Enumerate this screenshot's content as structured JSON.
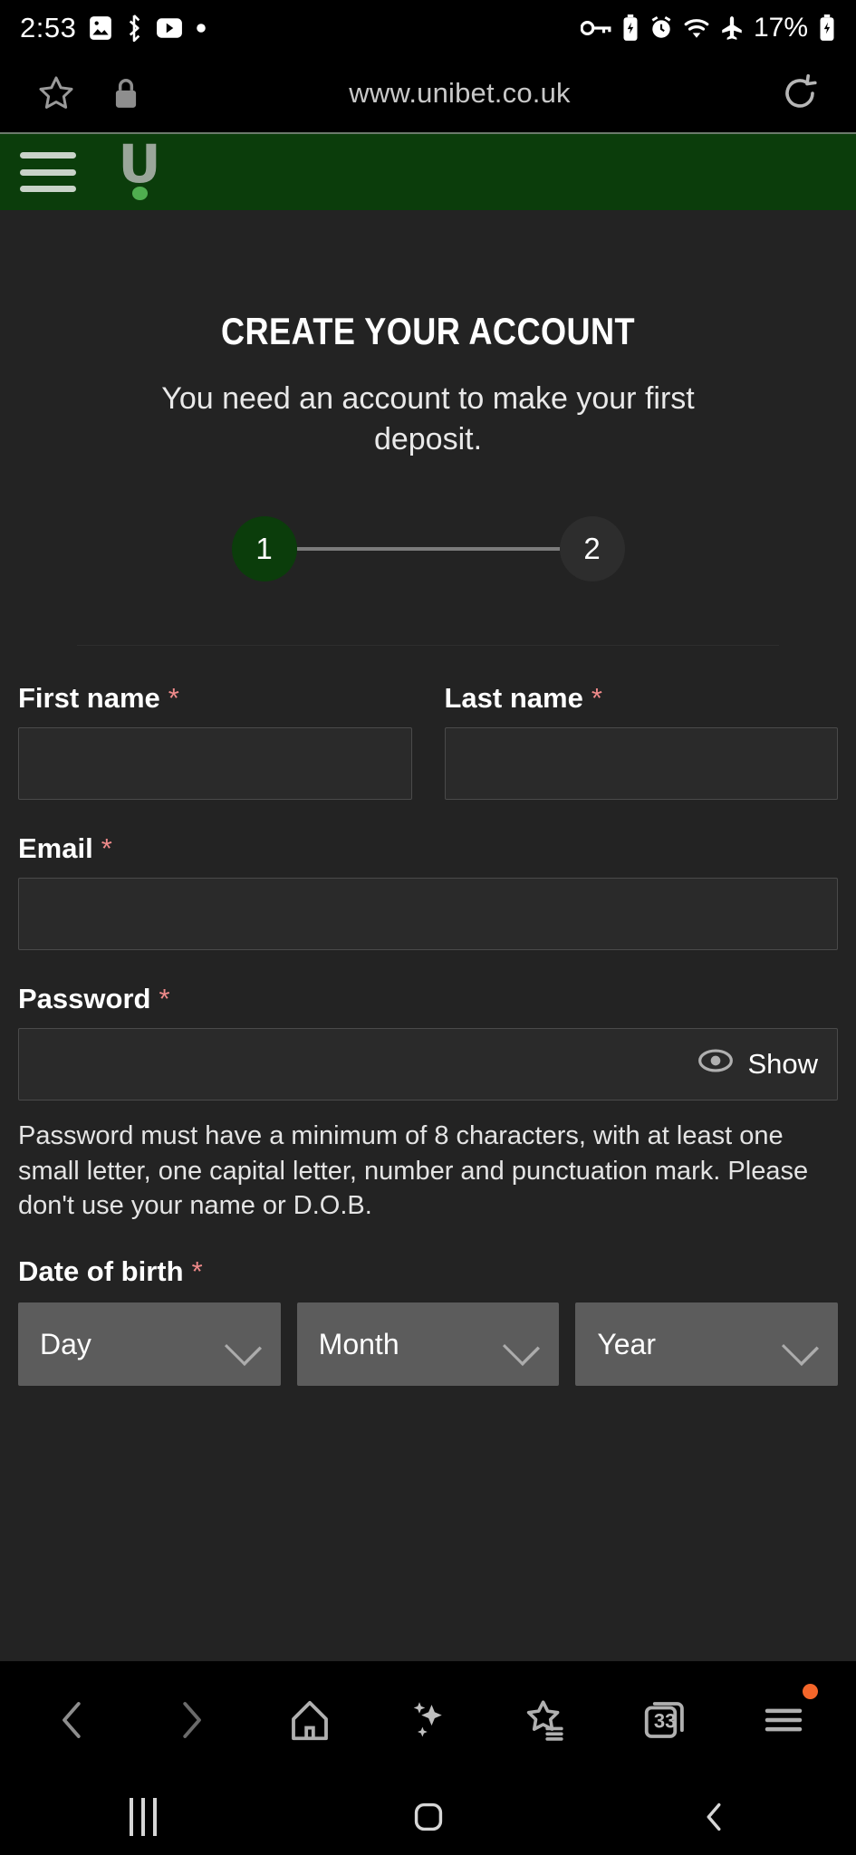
{
  "status_bar": {
    "time": "2:53",
    "battery_percent": "17%",
    "left_icons": [
      "photos-icon",
      "bluetooth-icon",
      "youtube-icon",
      "dot-icon"
    ],
    "right_icons": [
      "vpn-key-icon",
      "battery-saver-icon",
      "alarm-icon",
      "wifi-icon",
      "airplane-mode-icon",
      "battery-charging-icon"
    ]
  },
  "browser_url_bar": {
    "url": "www.unibet.co.uk",
    "bookmark_icon": "star-outline-icon",
    "security_icon": "lock-icon",
    "reload_icon": "reload-icon"
  },
  "site_header": {
    "menu_icon": "hamburger-menu-icon",
    "logo_letter": "U",
    "logo_name": "unibet-logo",
    "background_color": "#0b3d0b"
  },
  "page": {
    "title": "CREATE YOUR ACCOUNT",
    "subtitle": "You need an account to make your first deposit.",
    "steps": [
      {
        "number": "1",
        "state": "active"
      },
      {
        "number": "2",
        "state": "inactive"
      }
    ],
    "accent_color": "#0b3d0b",
    "required_marker": "*",
    "required_color": "#ef8a8a",
    "background_color": "#232323"
  },
  "form": {
    "first_name": {
      "label": "First name",
      "value": "",
      "placeholder": ""
    },
    "last_name": {
      "label": "Last name",
      "value": "",
      "placeholder": ""
    },
    "email": {
      "label": "Email",
      "value": "",
      "placeholder": ""
    },
    "password": {
      "label": "Password",
      "value": "",
      "placeholder": "",
      "toggle_label": "Show",
      "toggle_icon": "eye-icon",
      "hint": "Password must have a minimum of 8 characters, with at least one small letter, one capital letter, number and punctuation mark. Please don't use your name or D.O.B."
    },
    "date_of_birth": {
      "label": "Date of birth",
      "selects": [
        {
          "name": "day",
          "value": "Day"
        },
        {
          "name": "month",
          "value": "Month"
        },
        {
          "name": "year",
          "value": "Year"
        }
      ]
    }
  },
  "browser_toolbar": {
    "items": [
      {
        "name": "back-icon",
        "label": "Back"
      },
      {
        "name": "forward-icon",
        "label": "Forward"
      },
      {
        "name": "home-icon",
        "label": "Home"
      },
      {
        "name": "ai-sparkle-icon",
        "label": "Assistant"
      },
      {
        "name": "bookmarks-icon",
        "label": "Bookmarks"
      },
      {
        "name": "tabs-icon",
        "label": "Tabs"
      },
      {
        "name": "menu-icon",
        "label": "Menu"
      }
    ],
    "tab_count": "33",
    "menu_badge_color": "#f4662a"
  },
  "android_nav": {
    "recents_icon": "recents-icon",
    "home_icon": "home-square-icon",
    "back_icon": "back-chevron-icon"
  }
}
